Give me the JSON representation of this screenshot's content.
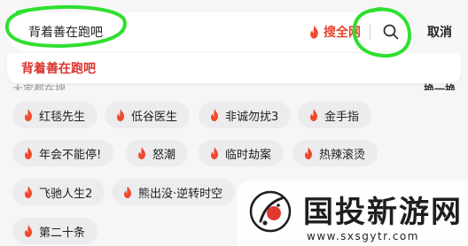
{
  "search": {
    "value": "背着善在跑吧",
    "whole_net_label": "搜全网",
    "cancel_label": "取消"
  },
  "suggestion": {
    "text": "背着善在跑吧"
  },
  "hot_header": {
    "left": "大家都在搜",
    "right": "换一换"
  },
  "tags": [
    {
      "label": "红毯先生"
    },
    {
      "label": "低谷医生"
    },
    {
      "label": "非诚勿扰3"
    },
    {
      "label": "金手指"
    },
    {
      "label": "年会不能停!"
    },
    {
      "label": "怒潮"
    },
    {
      "label": "临时劫案"
    },
    {
      "label": "热辣滚烫"
    },
    {
      "label": "飞驰人生2"
    },
    {
      "label": "熊出没·逆转时空"
    },
    {
      "label": "第二十条"
    }
  ],
  "watermark": {
    "name": "国投新游网",
    "url": "www.sxsgytr.com"
  },
  "colors": {
    "accent": "#e8442f",
    "suggest": "#d9342b",
    "marker": "#2ee02e"
  }
}
